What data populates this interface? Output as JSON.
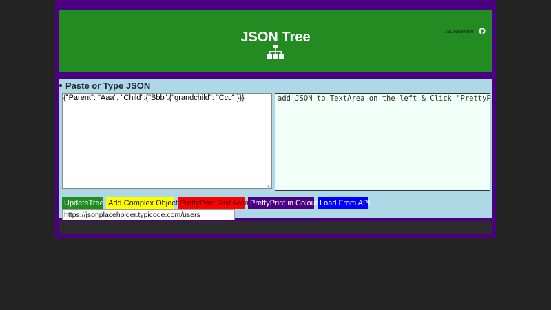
{
  "header": {
    "title": "JSON Tree",
    "render_link": "JSONRender",
    "icons": [
      "sitemap-icon",
      "github-icon"
    ]
  },
  "panel": {
    "section_title": "Paste or Type JSON",
    "input_value": "{\"Parent\": \"Aaa\", \"Child\":{\"Bbb\":{\"grandchild\": \"Ccc\" }}}",
    "output_text": "add JSON to TextArea on the left & Click \"PrettyPrin"
  },
  "buttons": {
    "update_tree": "UpdateTree",
    "add_complex": "Add Complex Object",
    "pretty_print_textarea": "PrettyPrint Text Area",
    "pretty_print_colour": "PrettyPrint in Colour",
    "load_api": "Load From API"
  },
  "api": {
    "url": "https://jsonplaceholder.typicode.com/users"
  },
  "colors": {
    "page_background": "#232323",
    "frame": "#4b0082",
    "header": "#228b22",
    "panel": "#add8e6",
    "output_background": "#f0fff8",
    "update_tree_button": "#228b22",
    "add_complex_button": "#ffff00",
    "pretty_print_textarea_button": "#ff0000",
    "pretty_print_colour_button": "#4b0082",
    "load_api_button": "#0000ff"
  }
}
